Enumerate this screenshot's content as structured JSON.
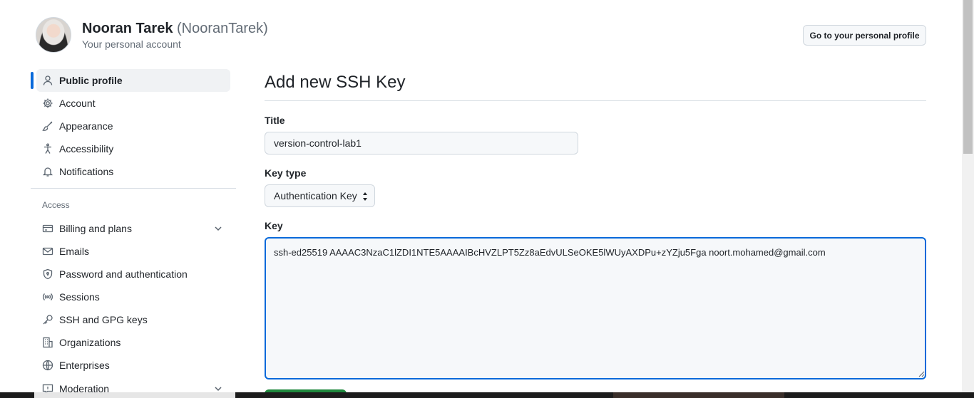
{
  "header": {
    "display_name": "Nooran Tarek",
    "login": "(NooranTarek)",
    "subtitle": "Your personal account",
    "profile_button": "Go to your personal profile"
  },
  "sidebar": {
    "items": [
      {
        "label": "Public profile",
        "icon": "person-icon",
        "active": true
      },
      {
        "label": "Account",
        "icon": "gear-icon"
      },
      {
        "label": "Appearance",
        "icon": "paintbrush-icon"
      },
      {
        "label": "Accessibility",
        "icon": "accessibility-icon"
      },
      {
        "label": "Notifications",
        "icon": "bell-icon"
      }
    ],
    "access_heading": "Access",
    "access_items": [
      {
        "label": "Billing and plans",
        "icon": "credit-card-icon",
        "expandable": true
      },
      {
        "label": "Emails",
        "icon": "mail-icon"
      },
      {
        "label": "Password and authentication",
        "icon": "shield-lock-icon"
      },
      {
        "label": "Sessions",
        "icon": "broadcast-icon"
      },
      {
        "label": "SSH and GPG keys",
        "icon": "key-icon"
      },
      {
        "label": "Organizations",
        "icon": "organization-icon"
      },
      {
        "label": "Enterprises",
        "icon": "globe-icon"
      },
      {
        "label": "Moderation",
        "icon": "report-icon",
        "expandable": true
      }
    ]
  },
  "main": {
    "title": "Add new SSH Key",
    "title_label": "Title",
    "title_value": "version-control-lab1",
    "key_type_label": "Key type",
    "key_type_value": "Authentication Key",
    "key_label": "Key",
    "key_value": "ssh-ed25519 AAAAC3NzaC1lZDI1NTE5AAAAIBcHVZLPT5Zz8aEdvULSeOKE5lWUyAXDPu+zYZju5Fga noort.mohamed@gmail.com"
  },
  "colors": {
    "accent": "#0969da",
    "primary_button": "#1f883d",
    "active_nav_bg": "#f0f2f4"
  }
}
